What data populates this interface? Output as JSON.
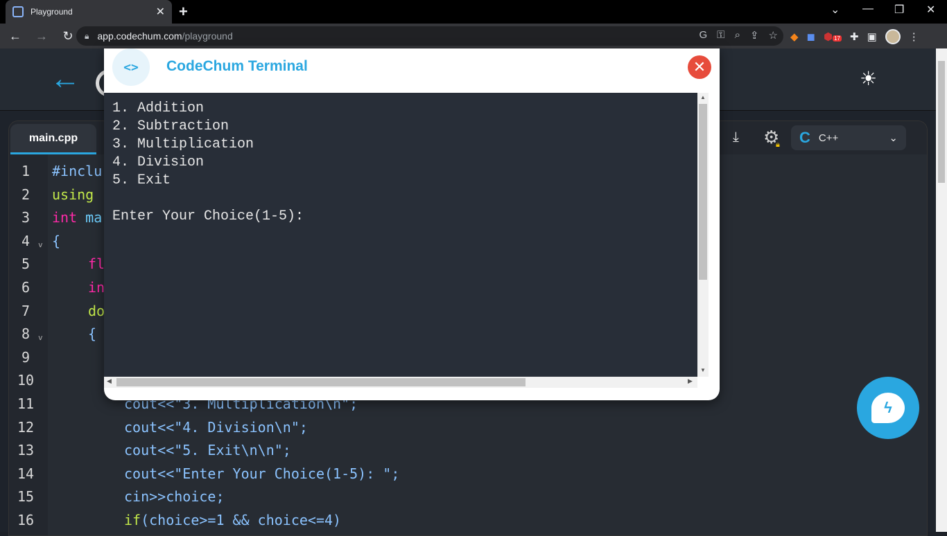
{
  "browser": {
    "tab_title": "Playground",
    "tab_close": "✕",
    "new_tab": "+",
    "url_domain": "app.codechum.com",
    "url_path": "/playground",
    "ext_badge": "17"
  },
  "app": {
    "file_tab": "main.cpp",
    "language": "C++"
  },
  "editor": {
    "line_numbers": [
      "1",
      "2",
      "3",
      "4",
      "5",
      "6",
      "7",
      "8",
      "9",
      "10",
      "11",
      "12",
      "13",
      "14",
      "15",
      "16"
    ],
    "visible_code": {
      "l1": "#inclu",
      "l2": "using",
      "l3_kw": "int",
      "l3_rest": " ma",
      "l4": "{",
      "l5": "fl",
      "l6": "in",
      "l7": "do",
      "l8": "{",
      "l11": "cout<<\"3. Multiplication\\n\";",
      "l12": "cout<<\"4. Division\\n\";",
      "l13": "cout<<\"5. Exit\\n\\n\";",
      "l14": "cout<<\"Enter Your Choice(1-5): \";",
      "l15": "cin>>choice;",
      "l16_kw": "if",
      "l16_rest": "(choice>=1 && choice<=4)"
    }
  },
  "terminal": {
    "title": "CodeChum Terminal",
    "icon": "<>",
    "lines": [
      "1. Addition",
      "2. Subtraction",
      "3. Multiplication",
      "4. Division",
      "5. Exit",
      "",
      "Enter Your Choice(1-5):"
    ]
  }
}
